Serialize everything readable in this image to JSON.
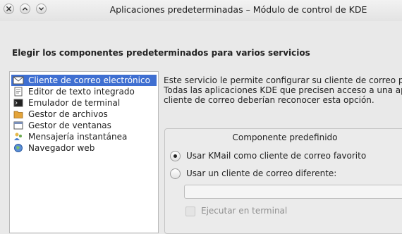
{
  "window": {
    "title": "Aplicaciones predeterminadas – Módulo de control de KDE",
    "controls": [
      "close-icon",
      "minimize-icon",
      "maximize-icon"
    ]
  },
  "heading": "Elegir los componentes predeterminados para varios servicios",
  "components": [
    {
      "label": "Cliente de correo electrónico",
      "icon": "mail-client-icon",
      "selected": true
    },
    {
      "label": "Editor de texto integrado",
      "icon": "text-editor-icon",
      "selected": false
    },
    {
      "label": "Emulador de terminal",
      "icon": "terminal-icon",
      "selected": false
    },
    {
      "label": "Gestor de archivos",
      "icon": "file-manager-icon",
      "selected": false
    },
    {
      "label": "Gestor de ventanas",
      "icon": "window-manager-icon",
      "selected": false
    },
    {
      "label": "Mensajería instantánea",
      "icon": "instant-messaging-icon",
      "selected": false
    },
    {
      "label": "Navegador web",
      "icon": "web-browser-icon",
      "selected": false
    }
  ],
  "description": [
    "Este servicio le permite configurar su cliente de correo pre",
    "Todas las aplicaciones KDE que precisen acceso a una aplic",
    "cliente de correo deberían reconocer esta opción."
  ],
  "panel": {
    "title": "Componente predefinido",
    "option_kmail": "Usar KMail como cliente de correo favorito",
    "option_other": "Usar un cliente de correo diferente:",
    "selected_option": "kmail",
    "client_value": "",
    "terminal_label": "Ejecutar en terminal",
    "terminal_checked": false,
    "terminal_enabled": false
  },
  "colors": {
    "selection": "#3f6fd1",
    "window_bg": "#e9e9e9"
  }
}
